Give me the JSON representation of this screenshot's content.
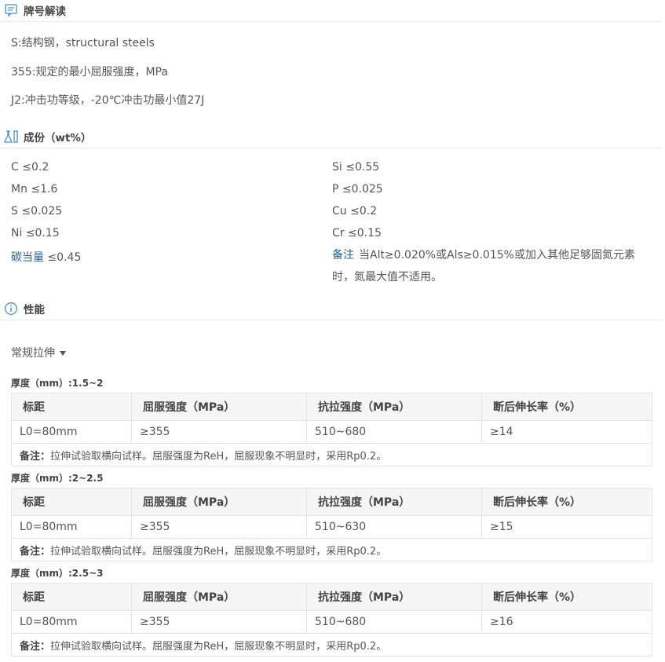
{
  "sections": {
    "designation": {
      "title": "牌号解读",
      "icon": "message-icon"
    },
    "composition": {
      "title": "成份（wt%）",
      "icon": "flask-icon"
    },
    "properties": {
      "title": "性能",
      "icon": "info-icon"
    }
  },
  "designation_lines": [
    "S:结构钢，structural steels",
    "355:规定的最小屈服强度，MPa",
    "J2:冲击功等级，-20℃冲击功最小值27J"
  ],
  "composition": {
    "left": [
      {
        "key": "C",
        "value": "≤0.2"
      },
      {
        "key": "Mn",
        "value": "≤1.6"
      },
      {
        "key": "S",
        "value": "≤0.025"
      },
      {
        "key": "Ni",
        "value": "≤0.15"
      },
      {
        "key": "碳当量",
        "value": "≤0.45"
      }
    ],
    "right": [
      {
        "key": "Si",
        "value": "≤0.55"
      },
      {
        "key": "P",
        "value": "≤0.025"
      },
      {
        "key": "Cu",
        "value": "≤0.2"
      },
      {
        "key": "Cr",
        "value": "≤0.15"
      }
    ],
    "note_key": "备注",
    "note_text": "当Alt≥0.020%或Als≥0.015%或加入其他足够固氮元素时，氮最大值不适用。"
  },
  "dropdown": {
    "label": "常规拉伸"
  },
  "table_headers": [
    "标距",
    "屈服强度（MPa）",
    "抗拉强度（MPa）",
    "断后伸长率（%）"
  ],
  "remark_key": "备注：",
  "remark_text": "拉伸试验取横向试样。屈服强度为ReH，屈服现象不明显时，采用Rp0.2。",
  "tensile_tables": [
    {
      "thickness": "厚度（mm）:1.5~2",
      "row": [
        "L0=80mm",
        "≥355",
        "510~680",
        "≥14"
      ]
    },
    {
      "thickness": "厚度（mm）:2~2.5",
      "row": [
        "L0=80mm",
        "≥355",
        "510~630",
        "≥15"
      ]
    },
    {
      "thickness": "厚度（mm）:2.5~3",
      "row": [
        "L0=80mm",
        "≥355",
        "510~680",
        "≥16"
      ]
    }
  ],
  "colors": {
    "accent": "#2e5f8a",
    "icon": "#4a90c8",
    "header_bg": "#f5f5f5",
    "border": "#e3e3e3"
  }
}
